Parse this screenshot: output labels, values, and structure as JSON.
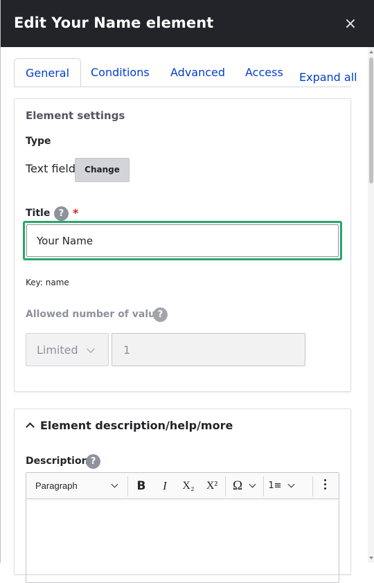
{
  "dialog": {
    "title": "Edit Your Name element",
    "close_label": "×"
  },
  "tabs": [
    {
      "label": "General",
      "active": true
    },
    {
      "label": "Conditions",
      "active": false
    },
    {
      "label": "Advanced",
      "active": false
    },
    {
      "label": "Access",
      "active": false
    }
  ],
  "expand_all": "Expand all",
  "element_settings": {
    "legend": "Element settings",
    "type_label": "Type",
    "type_value": "Text field",
    "change_button": "Change",
    "title_label": "Title",
    "title_help": "?",
    "required_marker": "*",
    "title_value": "Your Name",
    "key_text": "Key: name",
    "allowed_label": "Allowed number of values",
    "allowed_help": "?",
    "allowed_select": "Limited",
    "allowed_number": "1"
  },
  "description_section": {
    "header": "Element description/help/more",
    "description_label": "Description",
    "description_help": "?",
    "toolbar": {
      "paragraph": "Paragraph",
      "bold": "B",
      "italic": "I",
      "subscript": "X₂",
      "superscript": "X²",
      "special_chars": "Ω",
      "numbered_list": "1≡"
    }
  },
  "colors": {
    "titlebar_bg": "#232429",
    "link": "#003ecc",
    "focus": "#26a769",
    "required": "#d72222"
  }
}
